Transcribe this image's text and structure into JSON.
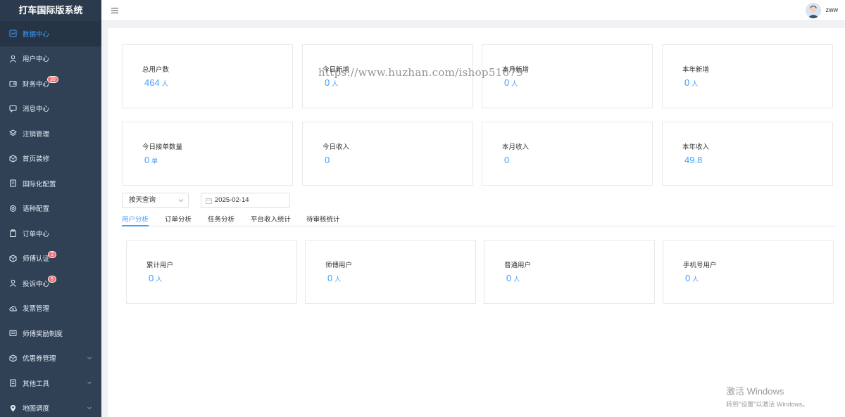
{
  "app": {
    "title": "打车国际版系统"
  },
  "sidebar": {
    "items": [
      {
        "label": "数据中心",
        "icon": "dashboard-icon",
        "active": true
      },
      {
        "label": "用户中心",
        "icon": "user-icon"
      },
      {
        "label": "财务中心",
        "icon": "wallet-icon",
        "badge": "30"
      },
      {
        "label": "消息中心",
        "icon": "message-icon"
      },
      {
        "label": "注销管理",
        "icon": "layers-icon"
      },
      {
        "label": "首页装修",
        "icon": "box-icon"
      },
      {
        "label": "国际化配置",
        "icon": "document-icon"
      },
      {
        "label": "语种配置",
        "icon": "gear-icon"
      },
      {
        "label": "订单中心",
        "icon": "clipboard-icon"
      },
      {
        "label": "师傅认证",
        "icon": "box-icon",
        "badge": "3"
      },
      {
        "label": "投诉中心",
        "icon": "user-icon",
        "badge": "9"
      },
      {
        "label": "发票管理",
        "icon": "cloud-upload-icon"
      },
      {
        "label": "师傅奖励制度",
        "icon": "list-icon"
      },
      {
        "label": "优惠券管理",
        "icon": "box-icon",
        "expandable": true
      },
      {
        "label": "其他工具",
        "icon": "document-icon",
        "expandable": true
      },
      {
        "label": "地图调度",
        "icon": "location-icon",
        "expandable": true
      }
    ]
  },
  "header": {
    "username": "zww"
  },
  "stats_row1": [
    {
      "label": "总用户数",
      "value": "464",
      "unit": "人"
    },
    {
      "label": "今日新增",
      "value": "0",
      "unit": "人"
    },
    {
      "label": "本月新增",
      "value": "0",
      "unit": "人"
    },
    {
      "label": "本年新增",
      "value": "0",
      "unit": "人"
    }
  ],
  "stats_row2": [
    {
      "label": "今日接单数量",
      "value": "0",
      "unit": "单"
    },
    {
      "label": "今日收入",
      "value": "0",
      "unit": ""
    },
    {
      "label": "本月收入",
      "value": "0",
      "unit": ""
    },
    {
      "label": "本年收入",
      "value": "49.8",
      "unit": ""
    }
  ],
  "filter": {
    "mode": "按天查询",
    "date": "2025-02-14"
  },
  "tabs": [
    "用户分析",
    "订单分析",
    "任务分析",
    "平台收入统计",
    "待审核统计"
  ],
  "user_stats": [
    {
      "label": "累计用户",
      "value": "0",
      "unit": "人"
    },
    {
      "label": "师傅用户",
      "value": "0",
      "unit": "人"
    },
    {
      "label": "普通用户",
      "value": "0",
      "unit": "人"
    },
    {
      "label": "手机号用户",
      "value": "0",
      "unit": "人"
    }
  ],
  "watermark": "https://www.huzhan.com/ishop51679",
  "windows_notice": {
    "line1": "激活 Windows",
    "line2": "转到\"设置\"以激活 Windows。"
  },
  "colors": {
    "sidebar": "#304156",
    "accent": "#409eff",
    "badge": "#f56c6c"
  }
}
